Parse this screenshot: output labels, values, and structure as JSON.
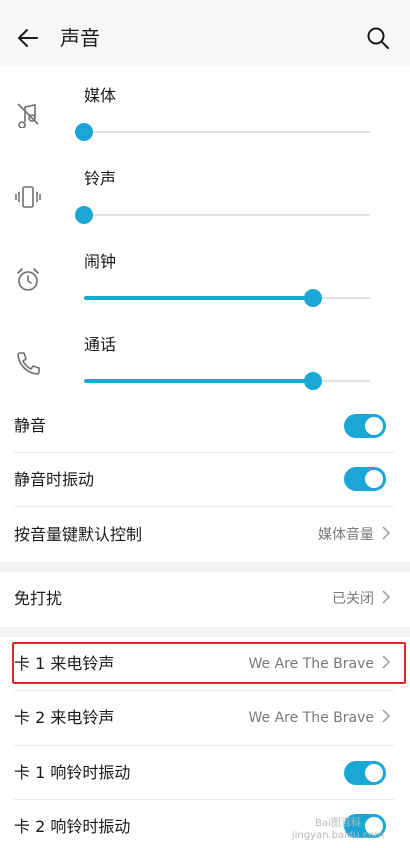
{
  "header": {
    "title": "声音",
    "back_icon": "arrow-left-icon",
    "search_icon": "search-icon"
  },
  "volume": {
    "accent_color": "#1ba7d5",
    "items": [
      {
        "label": "媒体",
        "icon": "media-muted-icon",
        "level": 0
      },
      {
        "label": "铃声",
        "icon": "vibrate-icon",
        "level": 0
      },
      {
        "label": "闹钟",
        "icon": "alarm-icon",
        "level": 0.8
      },
      {
        "label": "通话",
        "icon": "phone-icon",
        "level": 0.8
      }
    ]
  },
  "settings": {
    "mute": {
      "label": "静音",
      "on": true
    },
    "vibrate_when_muted": {
      "label": "静音时振动",
      "on": true
    },
    "volume_key_default": {
      "label": "按音量键默认控制",
      "value": "媒体音量"
    },
    "do_not_disturb": {
      "label": "免打扰",
      "value": "已关闭"
    },
    "card1_ringtone": {
      "label": "卡 1 来电铃声",
      "value": "We Are The Brave"
    },
    "card2_ringtone": {
      "label": "卡 2 来电铃声",
      "value": "We Are The Brave"
    },
    "card1_vibrate": {
      "label": "卡 1 响铃时振动",
      "on": true
    },
    "card2_vibrate": {
      "label": "卡 2 响铃时振动",
      "on": true
    }
  },
  "highlight_color": "#e0262d",
  "watermark": {
    "line1": "Bai图百科",
    "line2": "jingyan.baidu.com"
  }
}
